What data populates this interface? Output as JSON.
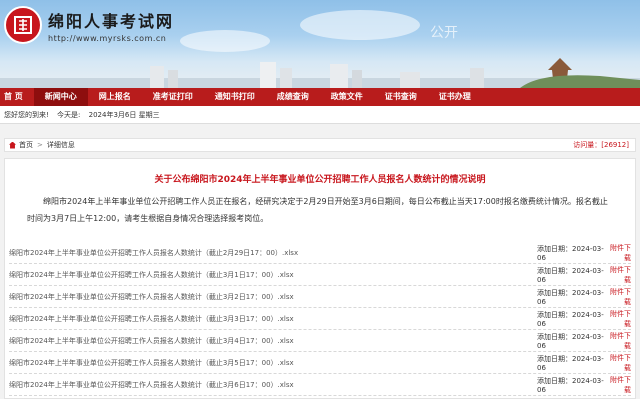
{
  "site": {
    "title": "绵阳人事考试网",
    "url": "http://www.myrsks.com.cn",
    "watermark": "公开"
  },
  "nav": {
    "items": [
      {
        "label": "首 页",
        "active": false
      },
      {
        "label": "新闻中心",
        "active": true
      },
      {
        "label": "网上报名",
        "active": false
      },
      {
        "label": "准考证打印",
        "active": false
      },
      {
        "label": "通知书打印",
        "active": false
      },
      {
        "label": "成绩查询",
        "active": false
      },
      {
        "label": "政策文件",
        "active": false
      },
      {
        "label": "证书查询",
        "active": false
      },
      {
        "label": "证书办理",
        "active": false
      }
    ]
  },
  "welcome": {
    "greeting": "您好您的到来!",
    "today": "今天是:",
    "date": "2024年3月6日 星期三"
  },
  "breadcrumb": {
    "home": "首页",
    "sep": ">",
    "current": "详细信息",
    "visits": "访问量：[26912]"
  },
  "article": {
    "title": "关于公布绵阳市2024年上半年事业单位公开招聘工作人员报名人数统计的情况说明",
    "body": "绵阳市2024年上半年事业单位公开招聘工作人员正在报名，经研究决定于2月29日开始至3月6日期间，每日公布截止当天17:00时报名缴费统计情况。报名截止时间为3月7日上午12:00，请考生根据自身情况合理选择报考岗位。",
    "attachments": [
      {
        "name": "绵阳市2024年上半年事业单位公开招聘工作人员报名人数统计（截止2月29日17：00）.xlsx",
        "date": "添加日期：2024-03-06",
        "download": "附件下载"
      },
      {
        "name": "绵阳市2024年上半年事业单位公开招聘工作人员报名人数统计（截止3月1日17：00）.xlsx",
        "date": "添加日期：2024-03-06",
        "download": "附件下载"
      },
      {
        "name": "绵阳市2024年上半年事业单位公开招聘工作人员报名人数统计（截止3月2日17：00）.xlsx",
        "date": "添加日期：2024-03-06",
        "download": "附件下载"
      },
      {
        "name": "绵阳市2024年上半年事业单位公开招聘工作人员报名人数统计（截止3月3日17：00）.xlsx",
        "date": "添加日期：2024-03-06",
        "download": "附件下载"
      },
      {
        "name": "绵阳市2024年上半年事业单位公开招聘工作人员报名人数统计（截止3月4日17：00）.xlsx",
        "date": "添加日期：2024-03-06",
        "download": "附件下载"
      },
      {
        "name": "绵阳市2024年上半年事业单位公开招聘工作人员报名人数统计（截止3月5日17：00）.xlsx",
        "date": "添加日期：2024-03-06",
        "download": "附件下载"
      },
      {
        "name": "绵阳市2024年上半年事业单位公开招聘工作人员报名人数统计（截止3月6日17：00）.xlsx",
        "date": "添加日期：2024-03-06",
        "download": "附件下载"
      }
    ]
  },
  "colors": {
    "brand_red": "#c8161d",
    "nav_red": "#b81c1c",
    "nav_active": "#8e0e0e"
  }
}
